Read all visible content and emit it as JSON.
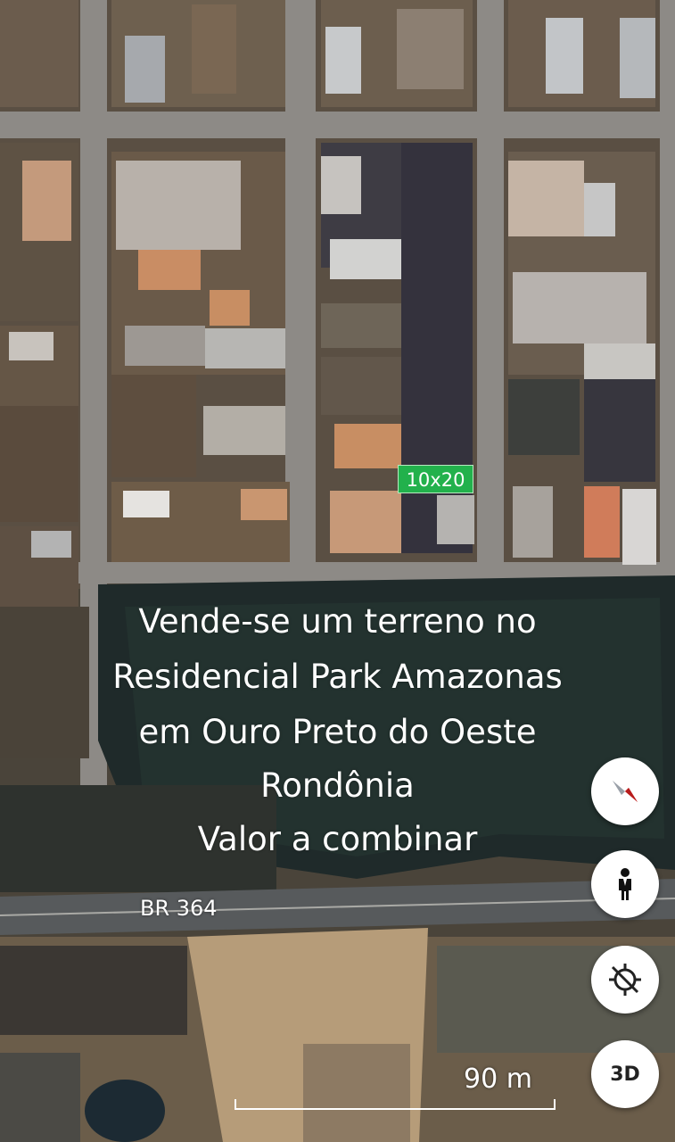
{
  "map": {
    "type": "satellite",
    "tag_label": "10x20",
    "road_label": "BR 364",
    "scale_label": "90 m",
    "colors": {
      "tag_bg": "#22b14c",
      "overlay_text": "#ffffff",
      "button_bg": "#ffffff",
      "compass_red": "#e53935"
    }
  },
  "overlay": {
    "lines": [
      "Vende-se um terreno no",
      "Residencial Park Amazonas",
      "em Ouro Preto do Oeste",
      "Rondônia",
      "Valor a combinar"
    ]
  },
  "controls": {
    "compass_icon": "compass-icon",
    "person_icon": "pegman-icon",
    "location_icon": "location-off-icon",
    "view3d_label": "3D"
  }
}
